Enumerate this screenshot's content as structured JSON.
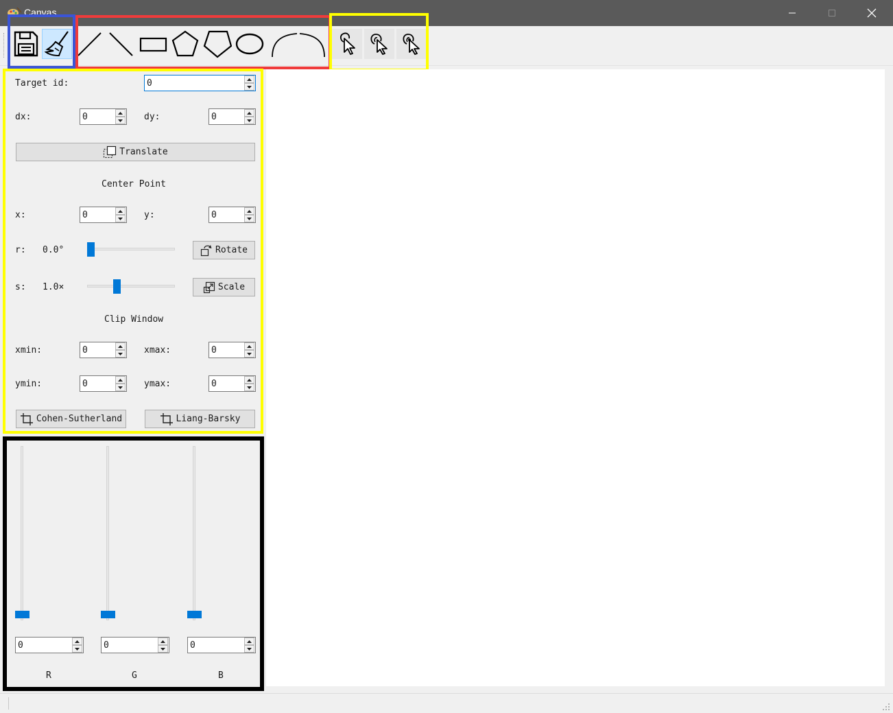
{
  "window": {
    "title": "Canvas"
  },
  "toolbar": {
    "groups": [
      {
        "name": "file",
        "items": [
          "save-icon",
          "clear-broom-icon"
        ],
        "highlight": "#3b55d6"
      },
      {
        "name": "draw",
        "items": [
          "line-forward-icon",
          "line-backward-icon",
          "rectangle-icon",
          "pentagon-icon",
          "polygon-icon",
          "ellipse-icon",
          "curve-left-icon",
          "curve-right-icon"
        ],
        "highlight": "#ef3b3b"
      },
      {
        "name": "select",
        "items": [
          "cursor-select-icon",
          "cursor-click-icon",
          "cursor-double-click-icon"
        ],
        "highlight": "#ffff00"
      }
    ]
  },
  "transform": {
    "target_id_label": "Target id:",
    "target_id_value": "0",
    "dx_label": "dx:",
    "dx_value": "0",
    "dy_label": "dy:",
    "dy_value": "0",
    "translate_label": "Translate",
    "center_point_label": "Center Point",
    "x_label": "x:",
    "x_value": "0",
    "y_label": "y:",
    "y_value": "0",
    "r_label": "r:",
    "r_value": "0.0°",
    "r_slider_fraction": 0.0,
    "rotate_label": "Rotate",
    "s_label": "s:",
    "s_value": "1.0×",
    "s_slider_fraction": 0.333,
    "scale_label": "Scale",
    "clip_window_label": "Clip Window",
    "xmin_label": "xmin:",
    "xmin_value": "0",
    "xmax_label": "xmax:",
    "xmax_value": "0",
    "ymin_label": "ymin:",
    "ymin_value": "0",
    "ymax_label": "ymax:",
    "ymax_value": "0",
    "cohen_label": "Cohen-Sutherland",
    "liang_label": "Liang-Barsky"
  },
  "color": {
    "channels": [
      {
        "label": "R",
        "value": "0",
        "slider_fraction": 0.0
      },
      {
        "label": "G",
        "value": "0",
        "slider_fraction": 0.0
      },
      {
        "label": "B",
        "value": "0",
        "slider_fraction": 0.0
      }
    ]
  },
  "colors": {
    "accent": "#0078d7",
    "titlebar": "#5a5a5a",
    "highlight_blue": "#3b55d6",
    "highlight_red": "#ef3b3b",
    "highlight_yellow": "#ffff00",
    "highlight_black": "#000000"
  }
}
